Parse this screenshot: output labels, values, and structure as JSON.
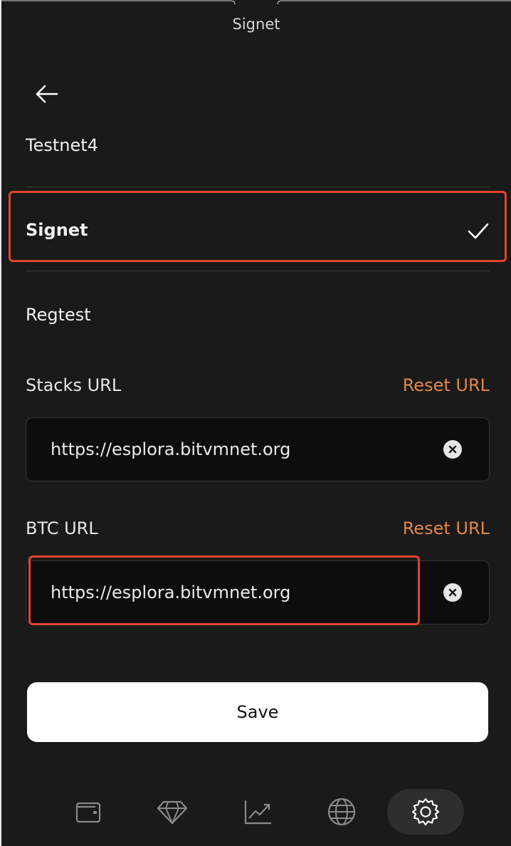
{
  "header": {
    "title": "Signet"
  },
  "networks": {
    "items": [
      {
        "label": "Testnet4"
      },
      {
        "label": "Signet",
        "selected": true
      },
      {
        "label": "Regtest"
      }
    ]
  },
  "stacks": {
    "label": "Stacks URL",
    "reset_label": "Reset URL",
    "value": "https://esplora.bitvmnet.org"
  },
  "btc": {
    "label": "BTC URL",
    "reset_label": "Reset URL",
    "value": "https://esplora.bitvmnet.org"
  },
  "save_label": "Save",
  "tabbar": {
    "items": [
      {
        "icon": "wallet-icon"
      },
      {
        "icon": "diamond-icon"
      },
      {
        "icon": "chart-icon"
      },
      {
        "icon": "globe-icon"
      },
      {
        "icon": "gear-icon",
        "active": true
      }
    ]
  },
  "colors": {
    "background": "#1a1a1a",
    "accent": "#e0874a",
    "highlight": "#e0442f",
    "input_bg": "#0d0d0d"
  }
}
